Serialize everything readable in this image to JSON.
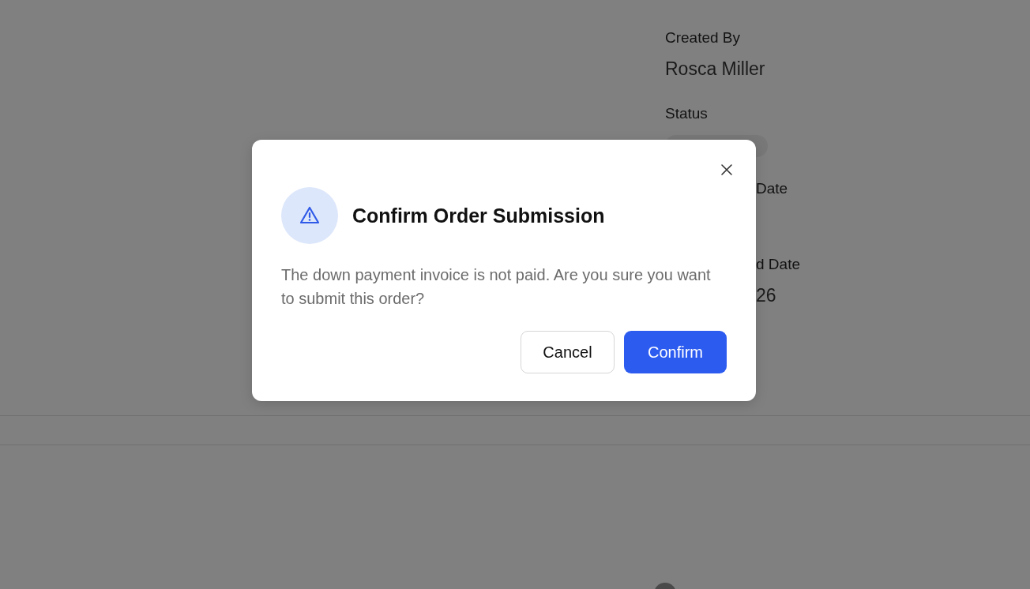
{
  "details": [
    {
      "kind": "label",
      "text": "Created By"
    },
    {
      "kind": "value",
      "text": "Rosca Miller"
    },
    {
      "kind": "label",
      "text": "Status"
    },
    {
      "kind": "pill"
    },
    {
      "kind": "label-cut",
      "text": "Date"
    },
    {
      "kind": "label-cut",
      "text": "d Date"
    },
    {
      "kind": "value-cut",
      "text": "26"
    }
  ],
  "dialog": {
    "title": "Confirm Order Submission",
    "message": "The down payment invoice is not paid. Are you sure you want to submit this order?",
    "buttons": [
      {
        "kind": "secondary",
        "label": "Cancel"
      },
      {
        "kind": "primary",
        "label": "Confirm"
      }
    ]
  }
}
